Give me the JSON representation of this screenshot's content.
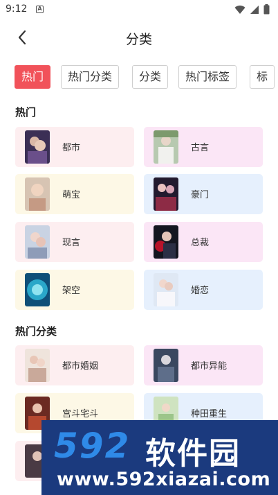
{
  "status_bar": {
    "time": "9:12",
    "notification_letter": "A",
    "icons": [
      "wifi-icon",
      "signal-icon",
      "battery-icon"
    ]
  },
  "header": {
    "title": "分类",
    "back_icon": "chevron-left-icon"
  },
  "tabs": [
    {
      "label": "热门",
      "active": true
    },
    {
      "label": "热门分类",
      "active": false
    },
    {
      "label": "分类",
      "active": false
    },
    {
      "label": "热门标签",
      "active": false
    },
    {
      "label": "标",
      "active": false
    }
  ],
  "sections": [
    {
      "title": "热门",
      "items": [
        {
          "label": "都市"
        },
        {
          "label": "古言"
        },
        {
          "label": "萌宝"
        },
        {
          "label": "豪门"
        },
        {
          "label": "现言"
        },
        {
          "label": "总裁"
        },
        {
          "label": "架空"
        },
        {
          "label": "婚恋"
        }
      ]
    },
    {
      "title": "热门分类",
      "items": [
        {
          "label": "都市婚姻"
        },
        {
          "label": "都市异能"
        },
        {
          "label": "宫斗宅斗"
        },
        {
          "label": "种田重生"
        }
      ]
    }
  ],
  "colors": {
    "accent": "#f1525a",
    "card_pink": "#fdeef0",
    "card_magenta": "#fbe6f6",
    "card_yellow": "#fdf8e6",
    "card_blue": "#e6f0fd"
  },
  "watermark": {
    "logo_number": "592",
    "logo_text": "软件园",
    "url": "www.592xiazai.com"
  }
}
